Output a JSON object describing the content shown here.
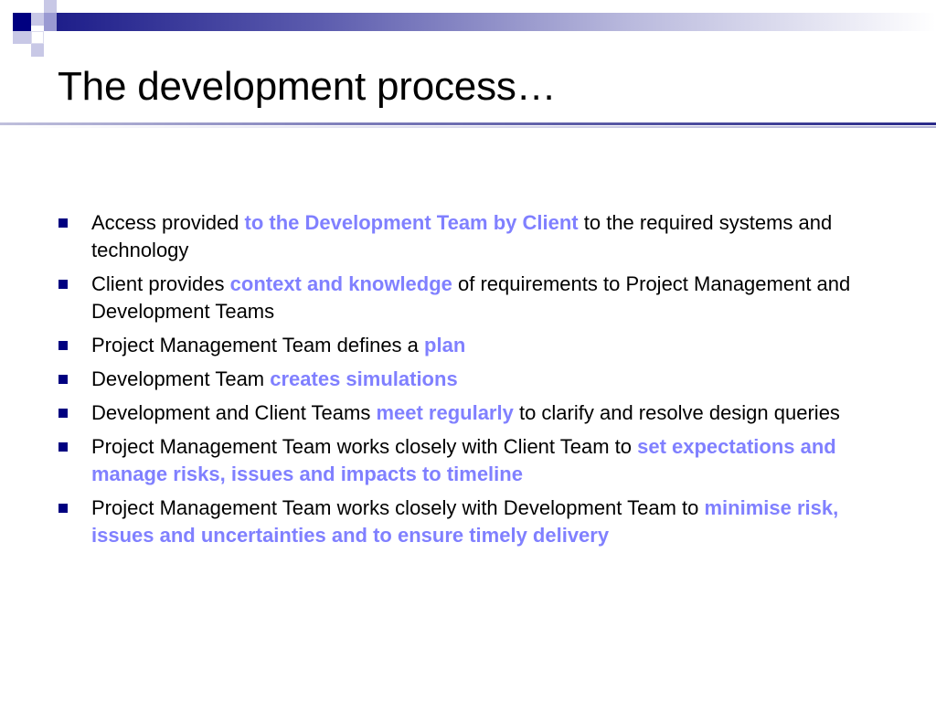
{
  "slide": {
    "title": "The development process…",
    "accent_colors": {
      "navy": "#000080",
      "highlight": "#8080ff",
      "lavender": "#b9b9dd"
    },
    "bullets": [
      {
        "parts": [
          {
            "text": "Access provided ",
            "highlight": false
          },
          {
            "text": "to the Development Team by Client",
            "highlight": true
          },
          {
            "text": " to the required systems and technology",
            "highlight": false
          }
        ]
      },
      {
        "parts": [
          {
            "text": "Client provides ",
            "highlight": false
          },
          {
            "text": "context and knowledge",
            "highlight": true
          },
          {
            "text": " of requirements to Project Management and Development Teams",
            "highlight": false
          }
        ]
      },
      {
        "parts": [
          {
            "text": "Project Management Team defines a ",
            "highlight": false
          },
          {
            "text": "plan",
            "highlight": true
          }
        ]
      },
      {
        "parts": [
          {
            "text": "Development Team ",
            "highlight": false
          },
          {
            "text": "creates simulations",
            "highlight": true
          }
        ]
      },
      {
        "parts": [
          {
            "text": "Development and Client Teams ",
            "highlight": false
          },
          {
            "text": "meet regularly",
            "highlight": true
          },
          {
            "text": " to clarify and resolve design queries",
            "highlight": false
          }
        ]
      },
      {
        "parts": [
          {
            "text": "Project Management Team works closely with Client Team to ",
            "highlight": false
          },
          {
            "text": "set expectations and manage risks, issues and impacts to timeline",
            "highlight": true
          }
        ]
      },
      {
        "parts": [
          {
            "text": "Project Management Team works closely with Development Team to ",
            "highlight": false
          },
          {
            "text": "minimise risk, issues and uncertainties and to ensure timely delivery",
            "highlight": true
          }
        ]
      }
    ]
  }
}
